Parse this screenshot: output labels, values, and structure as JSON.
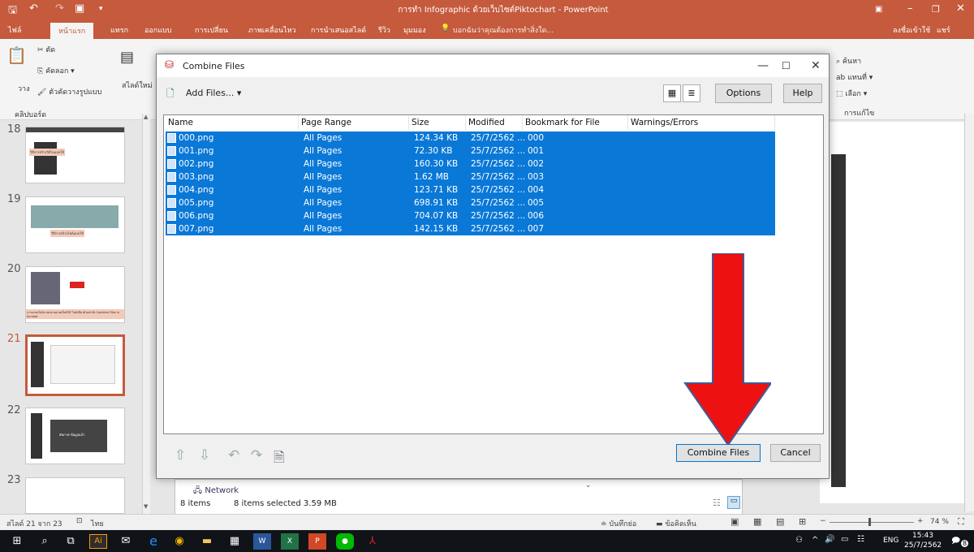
{
  "titlebar": {
    "title": "การทำ Infographic ด้วยเว็บไซต์Piktochart - PowerPoint"
  },
  "menu": {
    "tabs": [
      "ไฟล์",
      "หน้าแรก",
      "แทรก",
      "ออกแบบ",
      "การเปลี่ยน",
      "ภาพเคลื่อนไหว",
      "การนำเสนอสไลด์",
      "รีวิว",
      "มุมมอง"
    ],
    "tell_me": "บอกฉันว่าคุณต้องการทำสิ่งใด...",
    "signin": "ลงชื่อเข้าใช้",
    "share": "แชร์"
  },
  "ribbon": {
    "cut": "ตัด",
    "copy": "คัดลอก",
    "format_painter": "ตัวคัดวางรูปแบบ",
    "paste": "วาง",
    "clipboard": "คลิปบอร์ด",
    "new_slide": "สไลด์ใหม่",
    "find": "ค้นหา",
    "replace": "แทนที่",
    "select": "เลือก",
    "editing": "การแก้ไข"
  },
  "slides": {
    "numbers": [
      "18",
      "19",
      "20",
      "21",
      "22",
      "23"
    ],
    "captions": [
      "วิธีการสร้างวิดีโอแบบใช้",
      "วิธีการสร้างไฟล์แบบใช้",
      "การแปลงไฟล์ภาพหลายภาพเป็นPDF ไฟล์เดียวด้วยคำสั่ง Combine Files in Acrobat",
      "",
      "อัพภาพ ข้อมูลแล้ว",
      ""
    ]
  },
  "dialog": {
    "title": "Combine Files",
    "add_files": "Add Files...",
    "options": "Options",
    "help": "Help",
    "columns": [
      "Name",
      "Page Range",
      "Size",
      "Modified",
      "Bookmark for File",
      "Warnings/Errors"
    ],
    "rows": [
      {
        "name": "000.png",
        "range": "All Pages",
        "size": "124.34 KB",
        "modified": "25/7/2562 ...",
        "bookmark": "000"
      },
      {
        "name": "001.png",
        "range": "All Pages",
        "size": "72.30 KB",
        "modified": "25/7/2562 ...",
        "bookmark": "001"
      },
      {
        "name": "002.png",
        "range": "All Pages",
        "size": "160.30 KB",
        "modified": "25/7/2562 ...",
        "bookmark": "002"
      },
      {
        "name": "003.png",
        "range": "All Pages",
        "size": "1.62 MB",
        "modified": "25/7/2562 ...",
        "bookmark": "003"
      },
      {
        "name": "004.png",
        "range": "All Pages",
        "size": "123.71 KB",
        "modified": "25/7/2562 ...",
        "bookmark": "004"
      },
      {
        "name": "005.png",
        "range": "All Pages",
        "size": "698.91 KB",
        "modified": "25/7/2562 ...",
        "bookmark": "005"
      },
      {
        "name": "006.png",
        "range": "All Pages",
        "size": "704.07 KB",
        "modified": "25/7/2562 ...",
        "bookmark": "006"
      },
      {
        "name": "007.png",
        "range": "All Pages",
        "size": "142.15 KB",
        "modified": "25/7/2562 ...",
        "bookmark": "007"
      }
    ],
    "combine": "Combine Files",
    "cancel": "Cancel"
  },
  "explorer": {
    "network": "Network",
    "items": "8 items",
    "selected": "8 items selected  3.59 MB"
  },
  "status": {
    "slide_of": "สไลด์ 21 จาก 23",
    "lang": "ไทย",
    "notes": "บันทึกย่อ",
    "comments": "ข้อคิดเห็น",
    "zoom": "74 %"
  },
  "taskbar": {
    "lang": "ENG",
    "time": "15:43",
    "date": "25/7/2562",
    "notif": "8"
  },
  "colors": {
    "accent": "#c55a3c",
    "selection": "#0a78d7",
    "arrow": "#ee1111"
  }
}
